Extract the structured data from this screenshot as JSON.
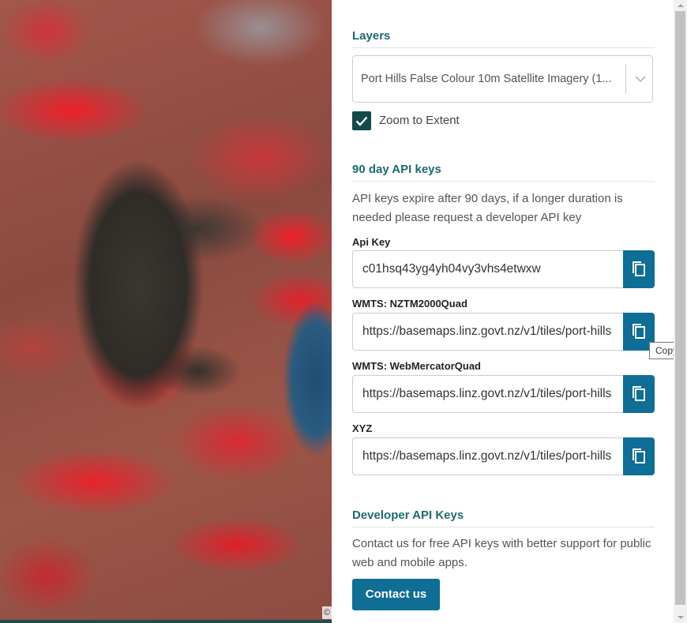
{
  "map": {
    "attribution_symbol": "©"
  },
  "layers": {
    "title": "Layers",
    "selected_layer": "Port Hills False Colour 10m Satellite Imagery (1...",
    "zoom_to_extent_label": "Zoom to Extent",
    "zoom_to_extent_checked": true
  },
  "api_keys": {
    "title": "90 day API keys",
    "description": "API keys expire after 90 days, if a longer duration is needed please request a developer API key",
    "fields": {
      "api_key": {
        "label": "Api Key",
        "value": "c01hsq43yg4yh04vy3vhs4etwxw"
      },
      "nztm": {
        "label": "WMTS: NZTM2000Quad",
        "value": "https://basemaps.linz.govt.nz/v1/tiles/port-hills"
      },
      "webmercator": {
        "label": "WMTS: WebMercatorQuad",
        "value": "https://basemaps.linz.govt.nz/v1/tiles/port-hills"
      },
      "xyz": {
        "label": "XYZ",
        "value": "https://basemaps.linz.govt.nz/v1/tiles/port-hills"
      }
    },
    "copy_tooltip": "Copy",
    "copy_icon": "copy-icon"
  },
  "developer": {
    "title": "Developer API Keys",
    "description": "Contact us for free API keys with better support for public web and mobile apps.",
    "contact_button": "Contact us"
  },
  "colors": {
    "accent_teal": "#1c6b6e",
    "button_blue": "#0e6e96",
    "checkbox_green": "#144a48"
  }
}
